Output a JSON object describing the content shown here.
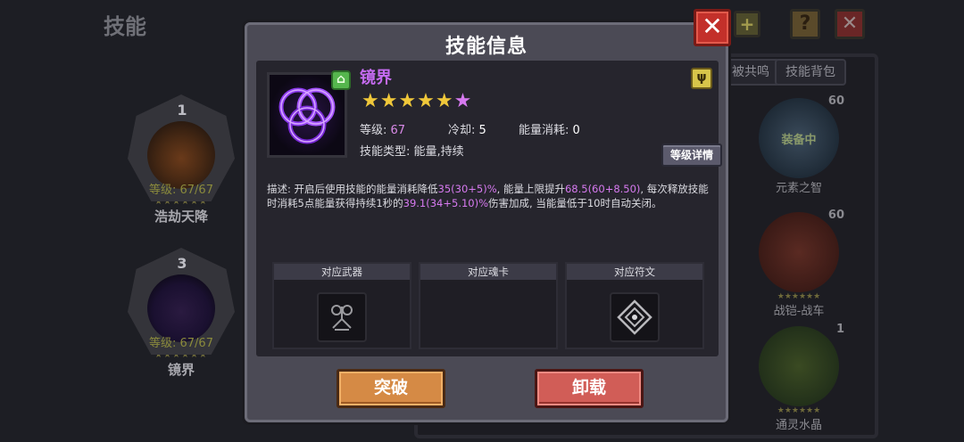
{
  "background": {
    "title": "技能",
    "top_buttons": {
      "help": "?",
      "close": "✕",
      "plus": "+"
    },
    "equipped_skills": [
      {
        "slot": "1",
        "level_label": "等级: 67/67",
        "stars": "★★★★★★",
        "name": "浩劫天降"
      },
      {
        "slot": "3",
        "level_label": "等级: 67/67",
        "stars": "★★★★★★",
        "name": "镜界"
      }
    ],
    "bag": {
      "tabs": [
        "被共鸣",
        "技能背包"
      ],
      "items": [
        {
          "name": "元素之智",
          "count": "60",
          "badge": "装备中",
          "stars": ""
        },
        {
          "name": "战铠-战车",
          "count": "60",
          "badge": "",
          "stars": "★★★★★★"
        },
        {
          "name": "通灵水晶",
          "count": "1",
          "badge": "",
          "stars": "★★★★★★"
        }
      ]
    }
  },
  "modal": {
    "title": "技能信息",
    "close_label": "✕",
    "skill": {
      "name": "镜界",
      "stars": "★★★★★",
      "star_extra": "★",
      "level_label": "等级:",
      "level": "67",
      "cooldown_label": "冷却:",
      "cooldown": "5",
      "energy_label": "能量消耗:",
      "energy": "0",
      "type_label": "技能类型:",
      "type": "能量,持续",
      "upgrade_badge": "⌂"
    },
    "level_detail_button": "等级详情",
    "description": {
      "p1": "描述: 开启后使用技能的能量消耗降低",
      "h1": "35(30+5)%",
      "p2": ", 能量上限提升",
      "h2": "68.5(60+8.50)",
      "p3": ", 每次释放技能时消耗5点能量获得持续1秒的",
      "h3": "39.1(34+5.10)%",
      "p4": "伤害加成, 当能量低于10时自动关闭。"
    },
    "slots": [
      {
        "label": "对应武器"
      },
      {
        "label": "对应魂卡"
      },
      {
        "label": "对应符文"
      }
    ],
    "buttons": {
      "break": "突破",
      "unload": "卸载"
    },
    "colors": {
      "accent_purple": "#c56bf0",
      "star_gold": "#f0c83a",
      "break_orange": "#d58a45",
      "unload_red": "#d15d57"
    }
  }
}
